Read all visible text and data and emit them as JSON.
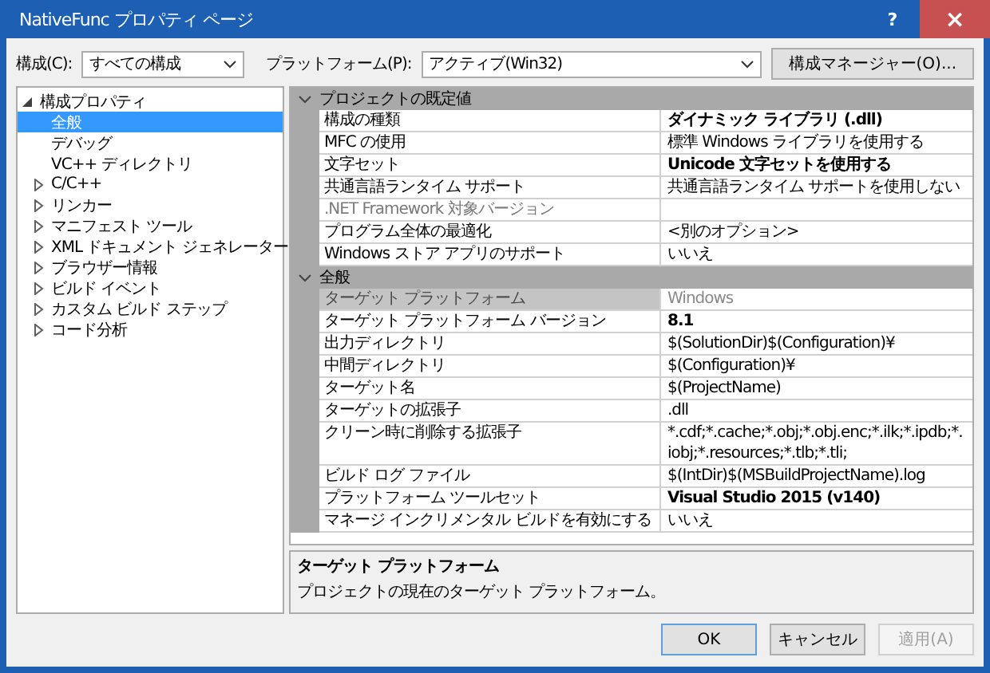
{
  "window": {
    "title": "NativeFunc プロパティ ページ",
    "help": "?",
    "close": "×"
  },
  "toolbar": {
    "config_label": "構成(C):",
    "config_value": "すべての構成",
    "platform_label": "プラットフォーム(P):",
    "platform_value": "アクティブ(Win32)",
    "manager_button": "構成マネージャー(O)..."
  },
  "tree": [
    {
      "label": "構成プロパティ",
      "kind": "group",
      "expanded": true,
      "selected": false,
      "children": [
        {
          "label": "全般",
          "kind": "page",
          "selected": true
        },
        {
          "label": "デバッグ",
          "kind": "page",
          "selected": false
        },
        {
          "label": "VC++ ディレクトリ",
          "kind": "page",
          "selected": false
        },
        {
          "label": "C/C++",
          "kind": "group",
          "expanded": false,
          "selected": false
        },
        {
          "label": "リンカー",
          "kind": "group",
          "expanded": false,
          "selected": false
        },
        {
          "label": "マニフェスト ツール",
          "kind": "group",
          "expanded": false,
          "selected": false
        },
        {
          "label": "XML ドキュメント ジェネレーター",
          "kind": "group",
          "expanded": false,
          "selected": false
        },
        {
          "label": "ブラウザー情報",
          "kind": "group",
          "expanded": false,
          "selected": false
        },
        {
          "label": "ビルド イベント",
          "kind": "group",
          "expanded": false,
          "selected": false
        },
        {
          "label": "カスタム ビルド ステップ",
          "kind": "group",
          "expanded": false,
          "selected": false
        },
        {
          "label": "コード分析",
          "kind": "group",
          "expanded": false,
          "selected": false
        }
      ]
    }
  ],
  "sections": [
    {
      "title": "プロジェクトの既定値",
      "expanded": true,
      "rows": [
        {
          "name": "構成の種類",
          "value": "ダイナミック ライブラリ (.dll)",
          "bold": true,
          "disabled": false,
          "selected": false
        },
        {
          "name": "MFC の使用",
          "value": "標準 Windows ライブラリを使用する",
          "bold": false,
          "disabled": false,
          "selected": false
        },
        {
          "name": "文字セット",
          "value": "Unicode 文字セットを使用する",
          "bold": true,
          "disabled": false,
          "selected": false
        },
        {
          "name": "共通言語ランタイム サポート",
          "value": "共通言語ランタイム サポートを使用しない",
          "bold": false,
          "disabled": false,
          "selected": false
        },
        {
          "name": ".NET Framework 対象バージョン",
          "bold": false,
          "disabled": true,
          "selected": false
        },
        {
          "name": "プログラム全体の最適化",
          "value": "<別のオプション>",
          "bold": false,
          "disabled": false,
          "selected": false
        },
        {
          "name": "Windows ストア アプリのサポート",
          "value": "いいえ",
          "bold": false,
          "disabled": false,
          "selected": false
        }
      ]
    },
    {
      "title": "全般",
      "expanded": true,
      "rows": [
        {
          "name": "ターゲット プラットフォーム",
          "value": "Windows",
          "bold": false,
          "disabled": true,
          "selected": true
        },
        {
          "name": "ターゲット プラットフォーム バージョン",
          "value": "8.1",
          "bold": true,
          "disabled": false,
          "selected": false
        },
        {
          "name": "出力ディレクトリ",
          "value": "$(SolutionDir)$(Configuration)¥",
          "bold": false,
          "disabled": false,
          "selected": false
        },
        {
          "name": "中間ディレクトリ",
          "value": "$(Configuration)¥",
          "bold": false,
          "disabled": false,
          "selected": false
        },
        {
          "name": "ターゲット名",
          "value": "$(ProjectName)",
          "bold": false,
          "disabled": false,
          "selected": false
        },
        {
          "name": "ターゲットの拡張子",
          "value": ".dll",
          "bold": false,
          "disabled": false,
          "selected": false
        },
        {
          "name": "クリーン時に削除する拡張子",
          "value": "*.cdf;*.cache;*.obj;*.obj.enc;*.ilk;*.ipdb;*.iobj;*.resources;*.tlb;*.tli;",
          "bold": false,
          "disabled": false,
          "selected": false
        },
        {
          "name": "ビルド ログ ファイル",
          "value": "$(IntDir)$(MSBuildProjectName).log",
          "bold": false,
          "disabled": false,
          "selected": false
        },
        {
          "name": "プラットフォーム ツールセット",
          "value": "Visual Studio 2015 (v140)",
          "bold": true,
          "disabled": false,
          "selected": false
        },
        {
          "name": "マネージ インクリメンタル ビルドを有効にする",
          "value": "いいえ",
          "bold": false,
          "disabled": false,
          "selected": false
        }
      ]
    }
  ],
  "description": {
    "title": "ターゲット プラットフォーム",
    "text": "プロジェクトの現在のターゲット プラットフォーム。"
  },
  "buttons": [
    {
      "label": "OK",
      "disabled": false
    },
    {
      "label": "キャンセル",
      "disabled": false
    },
    {
      "label": "適用(A)",
      "disabled": true
    }
  ]
}
